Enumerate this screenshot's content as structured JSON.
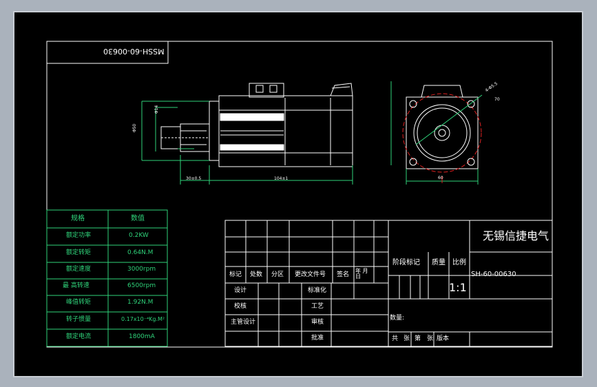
{
  "drawing": {
    "rotated_code": "MSSH-60-00630",
    "spec_table": {
      "header": [
        "规格",
        "数值"
      ],
      "rows": [
        [
          "额定功率",
          "0.2KW"
        ],
        [
          "额定转矩",
          "0.64N.M"
        ],
        [
          "额定速度",
          "3000rpm"
        ],
        [
          "最  高转速",
          "6500rpm"
        ],
        [
          "峰值转矩",
          "1.92N.M"
        ],
        [
          "转子惯量",
          "0.17x10⁻⁴Kg.M²"
        ],
        [
          "额定电流",
          "1800mA"
        ]
      ]
    },
    "dimensions": {
      "length_total": "104±1",
      "shaft_len": "30±0.5",
      "frame_size": "60",
      "pcd": "70",
      "flange_d": "Φ50",
      "shaft_d": "Φ14",
      "hole_d": "4-Φ5.5"
    },
    "title_block": {
      "company": "无锡信捷电气",
      "drawing_no": "SH-60-00630",
      "rev_headers": [
        "标记",
        "处数",
        "分区",
        "更改文件号",
        "签名",
        "年 月 日"
      ],
      "sign_rows": [
        [
          "设计",
          "标准化"
        ],
        [
          "校核",
          "工艺"
        ],
        [
          "主管设计",
          "审核"
        ],
        [
          "",
          "批准"
        ]
      ],
      "stage_headers": [
        "阶段标记",
        "质量",
        "比例"
      ],
      "scale": "1:1",
      "weight_label": "数量:",
      "sheet": [
        "共",
        "张",
        "第",
        "张"
      ],
      "version": "版本"
    }
  }
}
